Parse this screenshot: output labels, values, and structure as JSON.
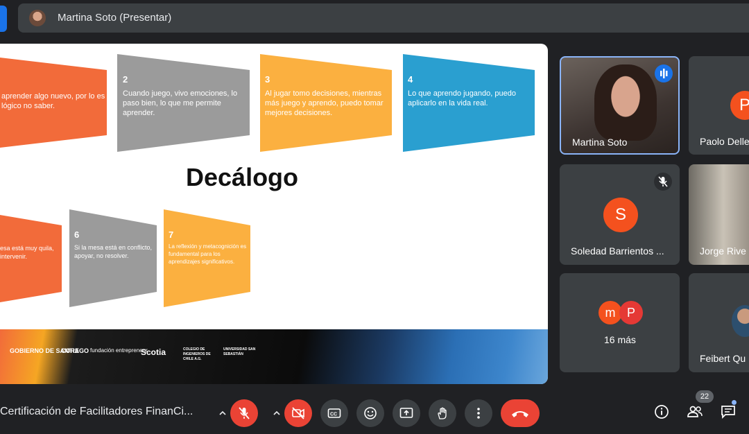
{
  "presenter": {
    "label": "Martina Soto (Presentar)"
  },
  "slide": {
    "title": "Decálogo",
    "cards": [
      {
        "num": "",
        "text": "aprender algo nuevo, por lo es lógico no saber.",
        "color": "#f26b3a"
      },
      {
        "num": "2",
        "text": "Cuando juego, vivo emociones, lo paso bien, lo que me permite aprender.",
        "color": "#9b9b9b"
      },
      {
        "num": "3",
        "text": "Al jugar tomo decisiones, mientras más juego y aprendo, puedo tomar mejores decisiones.",
        "color": "#fbb040"
      },
      {
        "num": "4",
        "text": "Lo que aprendo jugando, puedo aplicarlo en la vida real.",
        "color": "#2a9fd0"
      },
      {
        "num": "",
        "text": "esa está muy quila, intervenir.",
        "color": "#f26b3a"
      },
      {
        "num": "6",
        "text": "Si la mesa está en conflicto, apoyar, no resolver.",
        "color": "#9b9b9b"
      },
      {
        "num": "7",
        "text": "La reflexión y metacognición es fundamental para los aprendizajes significativos.",
        "color": "#fbb040"
      }
    ],
    "logos": [
      "GOBIERNO DE SANTIAGO",
      "CORE",
      "fundación entrepreneur",
      "Scotia",
      "COLEGIO DE INGENIEROS DE CHILE A.G.",
      "UNIVERSIDAD SAN SEBASTIÁN"
    ]
  },
  "participants": [
    {
      "name": "Martina Soto",
      "initial": "",
      "color": "#5a4a44"
    },
    {
      "name": "Paolo Delle",
      "initial": "P",
      "color": "#f4511e"
    },
    {
      "name": "Soledad Barrientos ...",
      "initial": "S",
      "color": "#f4511e"
    },
    {
      "name": "Jorge Rive",
      "initial": "",
      "color": "#6d6a63"
    },
    {
      "name": "16 más",
      "initial": "",
      "color": "#3c4043"
    },
    {
      "name": "Feibert Qu",
      "initial": "",
      "color": "#3c4043"
    }
  ],
  "more": {
    "a": "m",
    "b": "P"
  },
  "meeting": {
    "title": "Certificación de Facilitadores FinanCi..."
  },
  "people_count": "22",
  "icons": [
    "mic-off-icon",
    "camera-off-icon",
    "captions-icon",
    "emoji-icon",
    "present-icon",
    "raise-hand-icon",
    "more-icon",
    "end-call-icon",
    "info-icon",
    "people-icon",
    "chat-icon"
  ]
}
